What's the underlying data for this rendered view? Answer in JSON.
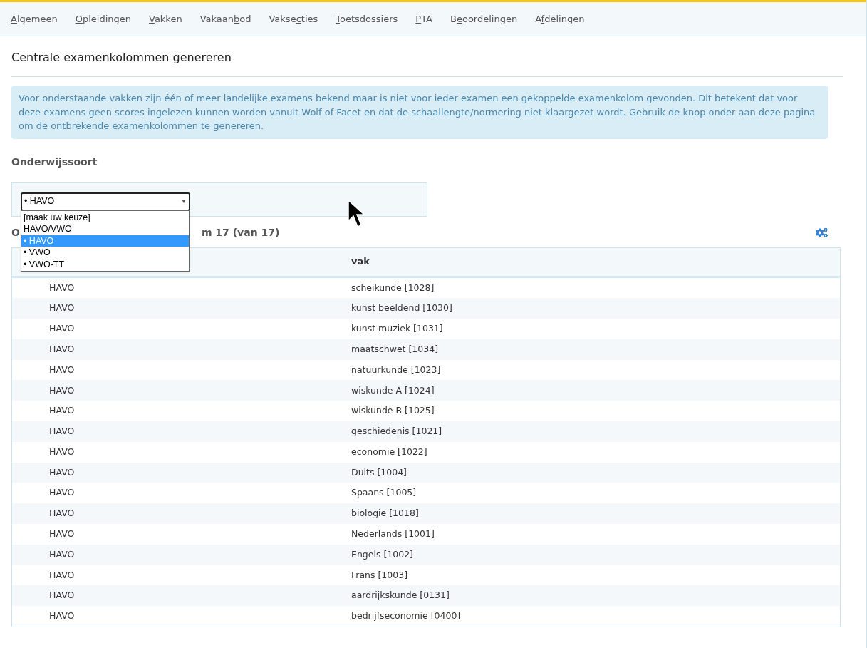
{
  "nav": [
    {
      "key": "A",
      "post": "lgemeen"
    },
    {
      "key": "O",
      "post": "pleidingen"
    },
    {
      "key": "V",
      "post": "akken"
    },
    {
      "pre": "Vakaan",
      "key": "b",
      "post": "od"
    },
    {
      "pre": "Vakse",
      "key": "c",
      "post": "ties"
    },
    {
      "key": "T",
      "post": "oetsdossiers"
    },
    {
      "key": "P",
      "post": "TA"
    },
    {
      "pre": "B",
      "key": "e",
      "post": "oordelingen"
    },
    {
      "pre": "A",
      "key": "f",
      "post": "delingen"
    }
  ],
  "title": "Centrale examenkolommen genereren",
  "info": "Voor onderstaande vakken zijn één of meer landelijke examens bekend maar is niet voor ieder examen een gekoppelde examenkolom gevonden. Dit betekent dat voor deze examens geen scores ingelezen kunnen worden vanuit Wolf of Facet en dat de schaallengte/normering niet klaargezet wordt. Gebruik de knop onder aan deze pagina om de ontbrekende examenkolommen te genereren.",
  "filter_label": "Onderwijssoort",
  "select": {
    "value": "• HAVO",
    "caret": "▼",
    "options": [
      {
        "label": "[maak uw keuze]",
        "selected": false
      },
      {
        "label": "HAVO/VWO",
        "selected": false
      },
      {
        "label": "• HAVO",
        "selected": true
      },
      {
        "label": "• VWO",
        "selected": false
      },
      {
        "label": "• VWO-TT",
        "selected": false
      }
    ]
  },
  "count_text": {
    "visible_start": "O",
    "visible_end": "m 17 (van 17)"
  },
  "table": {
    "columns": [
      "",
      "vak"
    ],
    "rows": [
      [
        "HAVO",
        "scheikunde [1028]"
      ],
      [
        "HAVO",
        "kunst beeldend [1030]"
      ],
      [
        "HAVO",
        "kunst muziek [1031]"
      ],
      [
        "HAVO",
        "maatschwet [1034]"
      ],
      [
        "HAVO",
        "natuurkunde [1023]"
      ],
      [
        "HAVO",
        "wiskunde A [1024]"
      ],
      [
        "HAVO",
        "wiskunde B [1025]"
      ],
      [
        "HAVO",
        "geschiedenis [1021]"
      ],
      [
        "HAVO",
        "economie [1022]"
      ],
      [
        "HAVO",
        "Duits [1004]"
      ],
      [
        "HAVO",
        "Spaans [1005]"
      ],
      [
        "HAVO",
        "biologie [1018]"
      ],
      [
        "HAVO",
        "Nederlands [1001]"
      ],
      [
        "HAVO",
        "Engels [1002]"
      ],
      [
        "HAVO",
        "Frans [1003]"
      ],
      [
        "HAVO",
        "aardrijkskunde [0131]"
      ],
      [
        "HAVO",
        "bedrijfseconomie [0400]"
      ]
    ]
  }
}
